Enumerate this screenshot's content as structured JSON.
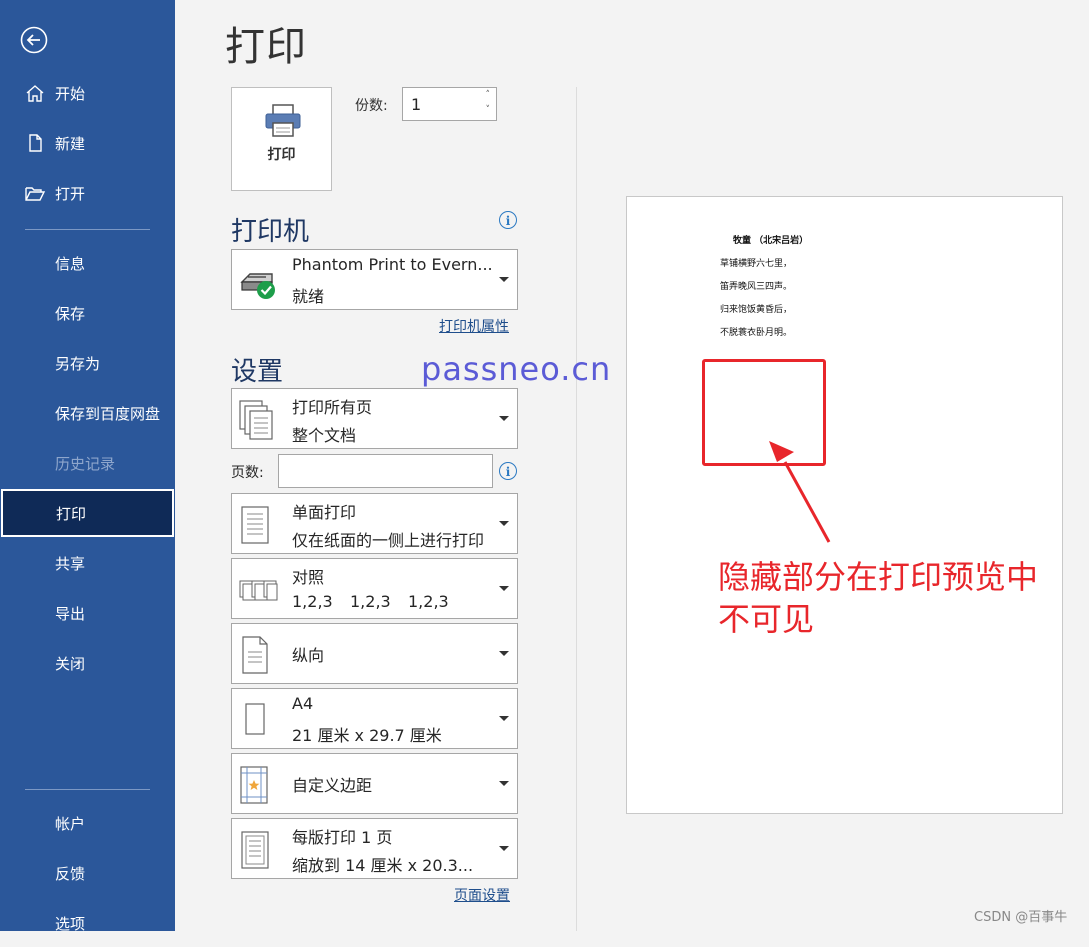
{
  "sidebar": {
    "items": [
      {
        "label": "开始"
      },
      {
        "label": "新建"
      },
      {
        "label": "打开"
      },
      {
        "label": "信息"
      },
      {
        "label": "保存"
      },
      {
        "label": "另存为"
      },
      {
        "label": "保存到百度网盘"
      },
      {
        "label": "历史记录"
      },
      {
        "label": "打印"
      },
      {
        "label": "共享"
      },
      {
        "label": "导出"
      },
      {
        "label": "关闭"
      },
      {
        "label": "帐户"
      },
      {
        "label": "反馈"
      },
      {
        "label": "选项"
      }
    ],
    "selected": "打印",
    "accent": "#2b579a"
  },
  "page_title": "打印",
  "print_button": {
    "label": "打印"
  },
  "copies": {
    "label": "份数:",
    "value": "1"
  },
  "printer": {
    "heading": "打印机",
    "name": "Phantom Print to Evern...",
    "status": "就绪",
    "properties_link": "打印机属性"
  },
  "settings": {
    "heading": "设置",
    "range": {
      "line1": "打印所有页",
      "line2": "整个文档"
    },
    "pages_label": "页数:",
    "pages_value": "",
    "sides": {
      "line1": "单面打印",
      "line2": "仅在纸面的一侧上进行打印"
    },
    "collate": {
      "line1": "对照",
      "nums": [
        "1,2,3",
        "1,2,3",
        "1,2,3"
      ]
    },
    "orientation": {
      "line1": "纵向"
    },
    "paper": {
      "line1": "A4",
      "line2": "21 厘米 x 29.7 厘米"
    },
    "margins": {
      "line1": "自定义边距"
    },
    "per_sheet": {
      "line1": "每版打印 1 页",
      "line2": "缩放到 14 厘米 x 20.3..."
    },
    "page_setup_link": "页面设置"
  },
  "preview": {
    "title": "牧童 （北宋吕岩）",
    "lines": [
      "草铺横野六七里，",
      "笛弄晚风三四声。",
      "归来饱饭黄昏后，",
      "不脱蓑衣卧月明。"
    ]
  },
  "watermark": "passneo.cn",
  "annotation": {
    "line1": "隐藏部分在打印预览中",
    "line2": "不可见",
    "color": "#e8262b"
  },
  "credit": "CSDN @百事牛"
}
